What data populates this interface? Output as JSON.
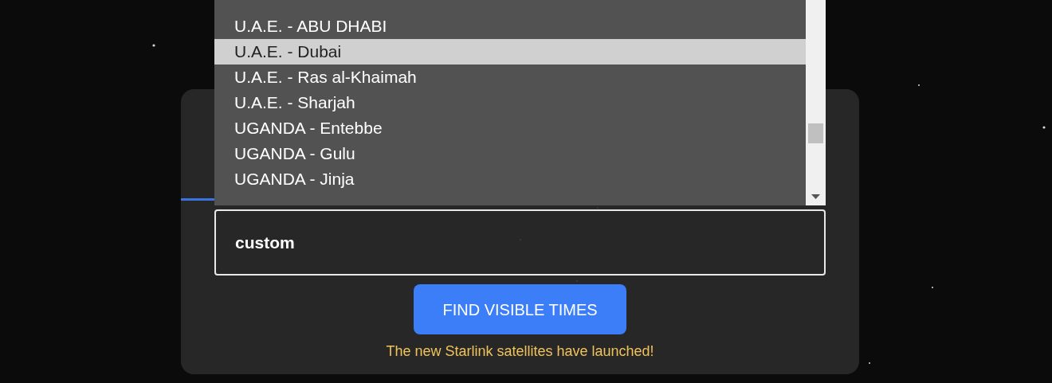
{
  "location_list": {
    "options": [
      {
        "label": "U.A.E. - ABU DHABI",
        "selected": false
      },
      {
        "label": "U.A.E. - Dubai",
        "selected": true
      },
      {
        "label": "U.A.E. - Ras al-Khaimah",
        "selected": false
      },
      {
        "label": "U.A.E. - Sharjah",
        "selected": false
      },
      {
        "label": "UGANDA - Entebbe",
        "selected": false
      },
      {
        "label": "UGANDA - Gulu",
        "selected": false
      },
      {
        "label": "UGANDA - Jinja",
        "selected": false
      }
    ]
  },
  "custom_field": {
    "value": "custom"
  },
  "find_button": "FIND VISIBLE TIMES",
  "notice": "The new Starlink satellites have launched!"
}
